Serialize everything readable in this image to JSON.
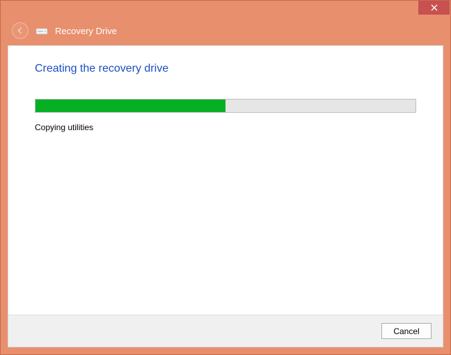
{
  "titlebar": {
    "close_label": "Close"
  },
  "header": {
    "title": "Recovery Drive"
  },
  "main": {
    "heading": "Creating the recovery drive",
    "progress_percent": 50,
    "status_text": "Copying utilities"
  },
  "footer": {
    "cancel_label": "Cancel"
  },
  "colors": {
    "frame": "#e88f6d",
    "close": "#c75050",
    "heading": "#1a4ec0",
    "progress_fill": "#06b025",
    "progress_track": "#e6e6e6"
  }
}
